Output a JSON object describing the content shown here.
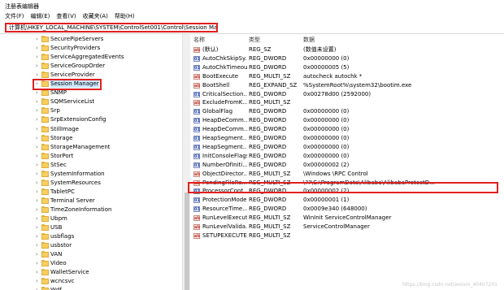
{
  "window": {
    "title": "注册表编辑器"
  },
  "menu": [
    "文件(F)",
    "编辑(E)",
    "查看(V)",
    "收藏夹(A)",
    "帮助(H)"
  ],
  "address": "计算机\\HKEY_LOCAL_MACHINE\\SYSTEM\\ControlSet001\\Control\\Session Manager",
  "tree": {
    "items": [
      "SecurePipeServers",
      "SecurityProviders",
      "ServiceAggregatedEvents",
      "ServiceGroupOrder",
      "ServiceProvider",
      "Session Manager",
      "SNMP",
      "SQMServiceList",
      "Srp",
      "SrpExtensionConfig",
      "StillImage",
      "Storage",
      "StorageManagement",
      "StorPort",
      "StSec",
      "SystemInformation",
      "SystemResources",
      "TabletPC",
      "Terminal Server",
      "TimeZoneInformation",
      "Ubpm",
      "USB",
      "usbflags",
      "usbstor",
      "VAN",
      "Video",
      "WalletService",
      "wcncsvc",
      "Wdf"
    ],
    "selected": "Session Manager"
  },
  "values": {
    "headers": {
      "name": "名称",
      "type": "类型",
      "data": "数据"
    },
    "rows": [
      {
        "icon": "ab",
        "name": "(默认)",
        "type": "REG_SZ",
        "data": "(数值未设置)"
      },
      {
        "icon": "bin",
        "name": "AutoChkSkipSy...",
        "type": "REG_DWORD",
        "data": "0x00000000 (0)"
      },
      {
        "icon": "bin",
        "name": "AutoChkTimeout",
        "type": "REG_DWORD",
        "data": "0x00000005 (5)"
      },
      {
        "icon": "ab",
        "name": "BootExecute",
        "type": "REG_MULTI_SZ",
        "data": "autocheck autochk *"
      },
      {
        "icon": "ab",
        "name": "BootShell",
        "type": "REG_EXPAND_SZ",
        "data": "%SystemRoot%\\system32\\bootim.exe"
      },
      {
        "icon": "bin",
        "name": "CriticalSection...",
        "type": "REG_DWORD",
        "data": "0x00278d00 (2592000)"
      },
      {
        "icon": "ab",
        "name": "ExcludeFromK...",
        "type": "REG_MULTI_SZ",
        "data": ""
      },
      {
        "icon": "bin",
        "name": "GlobalFlag",
        "type": "REG_DWORD",
        "data": "0x00000000 (0)"
      },
      {
        "icon": "bin",
        "name": "HeapDeComm...",
        "type": "REG_DWORD",
        "data": "0x00000000 (0)"
      },
      {
        "icon": "bin",
        "name": "HeapDeComm...",
        "type": "REG_DWORD",
        "data": "0x00000000 (0)"
      },
      {
        "icon": "bin",
        "name": "HeapSegment...",
        "type": "REG_DWORD",
        "data": "0x00000000 (0)"
      },
      {
        "icon": "bin",
        "name": "HeapSegment...",
        "type": "REG_DWORD",
        "data": "0x00000000 (0)"
      },
      {
        "icon": "bin",
        "name": "InitConsoleFlags",
        "type": "REG_DWORD",
        "data": "0x00000000 (0)"
      },
      {
        "icon": "bin",
        "name": "NumberOfIniti...",
        "type": "REG_DWORD",
        "data": "0x00000002 (2)"
      },
      {
        "icon": "ab",
        "name": "ObjectDirector...",
        "type": "REG_MULTI_SZ",
        "data": "\\Windows \\RPC Control"
      },
      {
        "icon": "ab",
        "name": "PendingFileRe...",
        "type": "REG_MULTI_SZ",
        "data": "\\??\\C:\\ProgramData\\Alibaba\\AlibabaProtectD..."
      },
      {
        "icon": "bin",
        "name": "ProcessorCont...",
        "type": "REG_DWORD",
        "data": "0x00000002 (2)"
      },
      {
        "icon": "bin",
        "name": "ProtectionMode",
        "type": "REG_DWORD",
        "data": "0x00000001 (1)"
      },
      {
        "icon": "bin",
        "name": "ResourceTime...",
        "type": "REG_DWORD",
        "data": "0x0009e340 (648000)"
      },
      {
        "icon": "ab",
        "name": "RunLevelExecute",
        "type": "REG_MULTI_SZ",
        "data": "WinInit ServiceControlManager"
      },
      {
        "icon": "ab",
        "name": "RunLevelValida...",
        "type": "REG_MULTI_SZ",
        "data": "ServiceControlManager"
      },
      {
        "icon": "ab",
        "name": "SETUPEXECUTE",
        "type": "REG_MULTI_SZ",
        "data": ""
      }
    ]
  },
  "watermark": "https://blog.csdn.net/weixin_40407201",
  "colors": {
    "highlight_border": "#e02020",
    "folder": "#f7cf5e",
    "selection": "#cce8ff"
  }
}
